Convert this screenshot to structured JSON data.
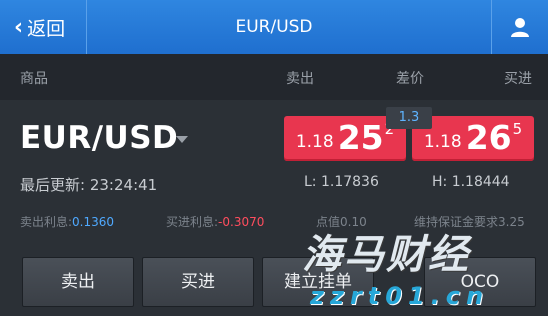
{
  "nav": {
    "back_label": "返回",
    "title": "EUR/USD"
  },
  "columns": {
    "product": "商品",
    "sell": "卖出",
    "spread": "差价",
    "buy": "买进"
  },
  "instrument": {
    "symbol": "EUR/USD",
    "updated_label": "最后更新:",
    "updated_time": "23:24:41",
    "sell": {
      "prefix": "1.18",
      "main": "25",
      "suffix": "2"
    },
    "buy": {
      "prefix": "1.18",
      "main": "26",
      "suffix": "5"
    },
    "spread": "1.3",
    "low": "L: 1.17836",
    "high": "H: 1.18444",
    "sell_interest_label": "卖出利息:",
    "sell_interest_value": "0.1360",
    "buy_interest_label": "买进利息:",
    "buy_interest_value": "-0.3070",
    "point_diff": "点值0.10",
    "margin_req": "维持保证金要求3.25"
  },
  "actions": {
    "sell": "卖出",
    "buy": "买进",
    "place_order": "建立挂单",
    "oco": "OCO"
  },
  "watermark": {
    "brand": "海马财经",
    "domain": "zzrt01.cn"
  },
  "colors": {
    "nav_blue": "#2a7fdb",
    "quote_red": "#e8364f",
    "spread_blue": "#5fb4ff"
  }
}
